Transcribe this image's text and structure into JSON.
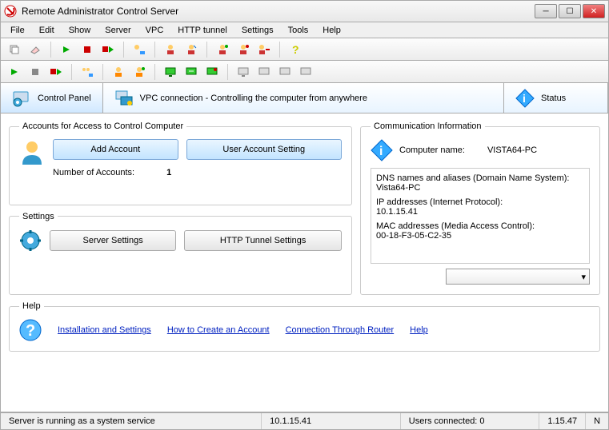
{
  "window": {
    "title": "Remote Administrator Control Server"
  },
  "menu": {
    "items": [
      "File",
      "Edit",
      "Show",
      "Server",
      "VPC",
      "HTTP tunnel",
      "Settings",
      "Tools",
      "Help"
    ]
  },
  "tabs": {
    "control_panel": "Control Panel",
    "vpc": "VPC connection - Controlling the computer from anywhere",
    "status": "Status"
  },
  "accounts": {
    "legend": "Accounts for Access to Control Computer",
    "add_btn": "Add Account",
    "settings_btn": "User Account Setting",
    "count_label": "Number of Accounts:",
    "count_value": "1"
  },
  "settings": {
    "legend": "Settings",
    "server_btn": "Server Settings",
    "http_btn": "HTTP Tunnel Settings"
  },
  "comm": {
    "legend": "Communication Information",
    "name_label": "Computer name:",
    "name_value": "VISTA64-PC",
    "dns_label": "DNS names and aliases (Domain Name System):",
    "dns_value": "Vista64-PC",
    "ip_label": "IP addresses (Internet Protocol):",
    "ip_value": "10.1.15.41",
    "mac_label": "MAC addresses (Media Access Control):",
    "mac_value": "00-18-F3-05-C2-35"
  },
  "help": {
    "legend": "Help",
    "install": "Installation and Settings",
    "create": "How to Create an Account",
    "router": "Connection Through Router",
    "help": "Help"
  },
  "status": {
    "service": "Server is running as a system service",
    "ip": "10.1.15.41",
    "users": "Users connected: 0",
    "version": "1.15.47",
    "extra": "N"
  }
}
